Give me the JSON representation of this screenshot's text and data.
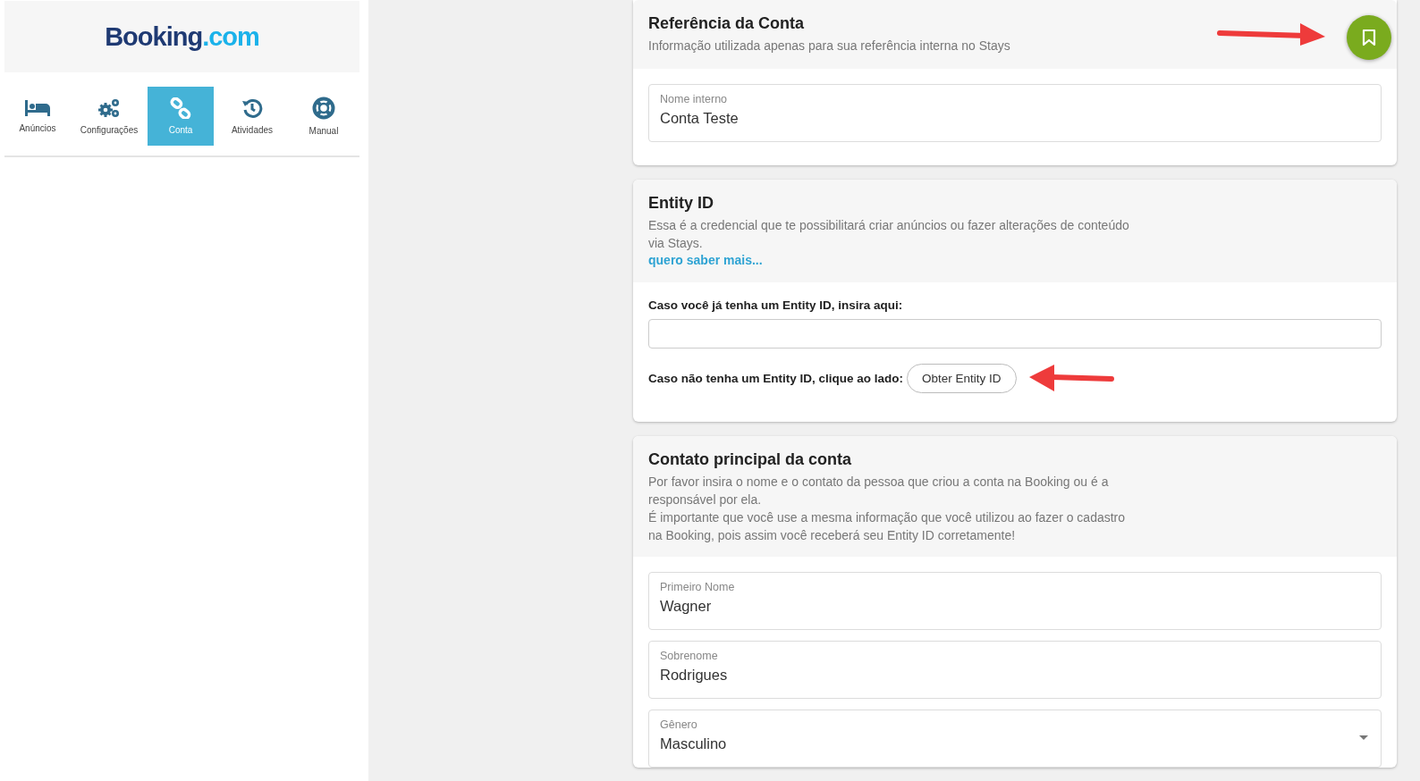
{
  "logo": {
    "brand": "Booking",
    "suffix": ".com"
  },
  "nav": [
    {
      "label": "Anúncios",
      "selected": false
    },
    {
      "label": "Configurações",
      "selected": false
    },
    {
      "label": "Conta",
      "selected": true
    },
    {
      "label": "Atividades",
      "selected": false
    },
    {
      "label": "Manual",
      "selected": false
    }
  ],
  "account_reference": {
    "title": "Referência da Conta",
    "subtitle": "Informação utilizada apenas para sua referência interna no Stays",
    "fields": [
      {
        "kind": "text",
        "label": "Nome interno",
        "value": "Conta Teste"
      }
    ]
  },
  "entity_id": {
    "title": "Entity ID",
    "description": "Essa é a credencial que te possibilitará criar anúncios ou fazer alterações de conteúdo via Stays.",
    "link": "quero saber mais...",
    "input_label": "Caso você já tenha um Entity ID, insira aqui:",
    "button_prompt": "Caso não tenha um Entity ID, clique ao lado:",
    "button": "Obter Entity ID"
  },
  "main_contact": {
    "title": "Contato principal da conta",
    "paragraphs": [
      "Por favor insira o nome e o contato da pessoa que criou a conta na Booking ou é a responsável por ela.",
      "É importante que você use a mesma informação que você utilizou ao fazer o cadastro na Booking, pois assim você receberá seu Entity ID corretamente!"
    ],
    "fields": [
      {
        "kind": "text",
        "label": "Primeiro Nome",
        "value": "Wagner"
      },
      {
        "kind": "text",
        "label": "Sobrenome",
        "value": "Rodrigues"
      },
      {
        "kind": "select",
        "label": "Gênero",
        "value": "Masculino"
      }
    ]
  }
}
